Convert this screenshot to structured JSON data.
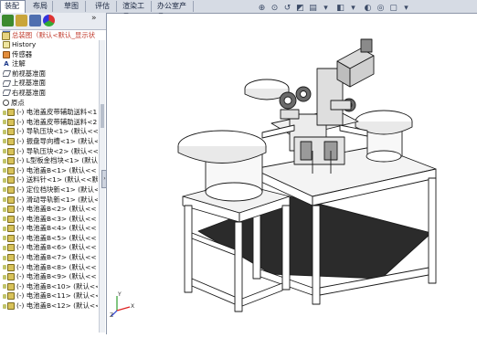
{
  "tabs": [
    {
      "label": "装配体",
      "active": true
    },
    {
      "label": "布局",
      "active": false
    },
    {
      "label": "草图",
      "active": false
    },
    {
      "label": "评估",
      "active": false
    },
    {
      "label": "渲染工具",
      "active": false
    },
    {
      "label": "办公室产品",
      "active": false
    }
  ],
  "panel": {
    "root_label": "总装图（默认<默认_显示状",
    "items": [
      {
        "label": "History",
        "icon": "history-icon"
      },
      {
        "label": "传感器",
        "icon": "sensor-icon"
      },
      {
        "label": "注解",
        "icon": "annotation-icon"
      },
      {
        "label": "前视基准面",
        "icon": "plane-icon"
      },
      {
        "label": "上视基准面",
        "icon": "plane-icon"
      },
      {
        "label": "右视基准面",
        "icon": "plane-icon"
      },
      {
        "label": "原点",
        "icon": "origin-icon"
      },
      {
        "label": "(-) 电池盖皮带辅助送料<1",
        "icon": "part-icon"
      },
      {
        "label": "(-) 电池盖皮带辅助送料<2",
        "icon": "part-icon"
      },
      {
        "label": "(-) 导轨压块<1> (默认<<",
        "icon": "part-icon"
      },
      {
        "label": "(-) 振盘导向槽<1> (默认<",
        "icon": "part-icon"
      },
      {
        "label": "(-) 导轨压块<2> (默认<<",
        "icon": "part-icon"
      },
      {
        "label": "(-) L型板金档块<1> (默认<",
        "icon": "part-icon"
      },
      {
        "label": "(-) 电池盖B<1> (默认<<",
        "icon": "part-icon"
      },
      {
        "label": "(-) 送料针<1> (默认<<默",
        "icon": "part-icon"
      },
      {
        "label": "(-) 定位档块新<1> (默认<",
        "icon": "part-icon"
      },
      {
        "label": "(-) 滑动导轨新<1> (默认<",
        "icon": "part-icon"
      },
      {
        "label": "(-) 电池盖B<2> (默认<<",
        "icon": "part-icon"
      },
      {
        "label": "(-) 电池盖B<3> (默认<<",
        "icon": "part-icon"
      },
      {
        "label": "(-) 电池盖B<4> (默认<<",
        "icon": "part-icon"
      },
      {
        "label": "(-) 电池盖B<5> (默认<<",
        "icon": "part-icon"
      },
      {
        "label": "(-) 电池盖B<6> (默认<<",
        "icon": "part-icon"
      },
      {
        "label": "(-) 电池盖B<7> (默认<<",
        "icon": "part-icon"
      },
      {
        "label": "(-) 电池盖B<8> (默认<<",
        "icon": "part-icon"
      },
      {
        "label": "(-) 电池盖B<9> (默认<<",
        "icon": "part-icon"
      },
      {
        "label": "(-) 电池盖B<10> (默认<<",
        "icon": "part-icon"
      },
      {
        "label": "(-) 电池盖B<11> (默认<<",
        "icon": "part-icon"
      },
      {
        "label": "(-) 电池盖B<12> (默认<<",
        "icon": "part-icon"
      }
    ]
  },
  "triad": {
    "x": "X",
    "y": "Y",
    "z": "Z"
  },
  "colors": {
    "tab_bar": "#d6dbe4",
    "panel_border": "#8e98aa",
    "part_icon": "#d8c25a",
    "floor": "#2a2a2a"
  }
}
